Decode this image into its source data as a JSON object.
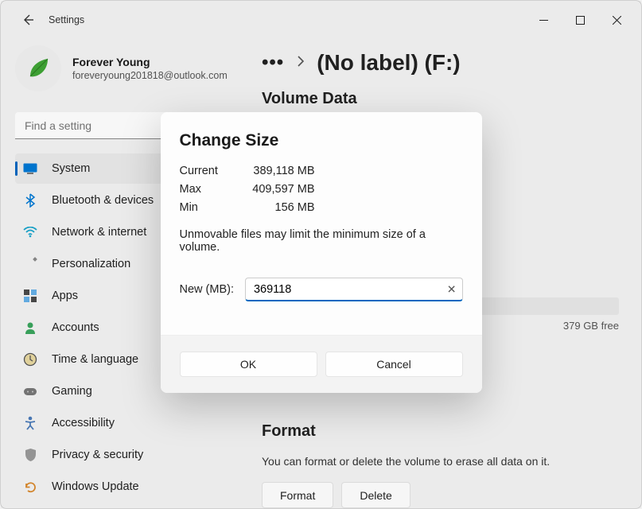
{
  "window": {
    "title": "Settings"
  },
  "profile": {
    "name": "Forever Young",
    "email": "foreveryoung201818@outlook.com"
  },
  "search": {
    "placeholder": "Find a setting"
  },
  "nav": {
    "items": [
      {
        "label": "System"
      },
      {
        "label": "Bluetooth & devices"
      },
      {
        "label": "Network & internet"
      },
      {
        "label": "Personalization"
      },
      {
        "label": "Apps"
      },
      {
        "label": "Accounts"
      },
      {
        "label": "Time & language"
      },
      {
        "label": "Gaming"
      },
      {
        "label": "Accessibility"
      },
      {
        "label": "Privacy & security"
      },
      {
        "label": "Windows Update"
      }
    ]
  },
  "breadcrumb": {
    "more": "…",
    "current": "(No label) (F:)"
  },
  "volume": {
    "heading": "Volume Data",
    "free": "379 GB free"
  },
  "format": {
    "heading": "Format",
    "desc": "You can format or delete the volume to erase all data on it.",
    "format_btn": "Format",
    "delete_btn": "Delete"
  },
  "dialog": {
    "title": "Change Size",
    "current_lbl": "Current",
    "current_val": "389,118 MB",
    "max_lbl": "Max",
    "max_val": "409,597 MB",
    "min_lbl": "Min",
    "min_val": "156 MB",
    "note": "Unmovable files may limit the minimum size of a volume.",
    "new_lbl": "New (MB):",
    "new_val": "369118",
    "ok": "OK",
    "cancel": "Cancel"
  }
}
